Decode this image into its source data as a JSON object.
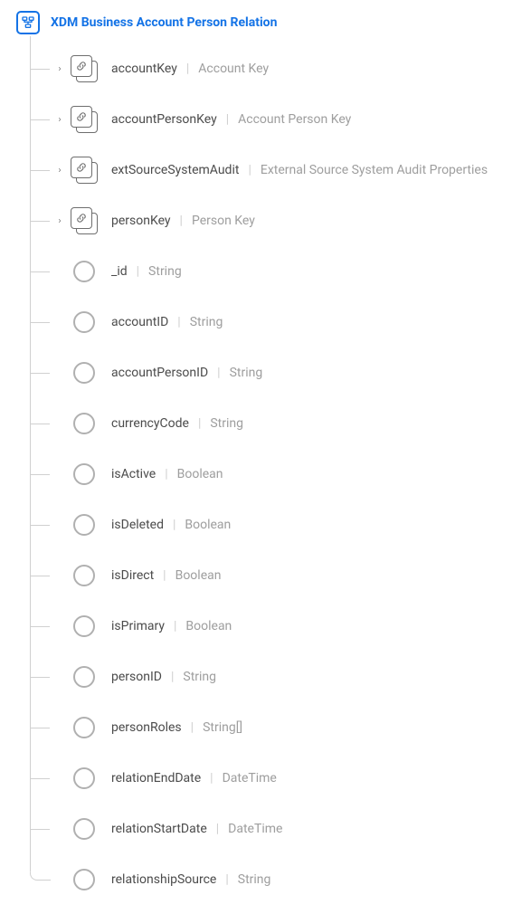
{
  "root": {
    "title": "XDM Business Account Person Relation",
    "icon": "schema-icon"
  },
  "nodes": [
    {
      "kind": "object",
      "expandable": true,
      "name": "accountKey",
      "desc": "Account Key"
    },
    {
      "kind": "object",
      "expandable": true,
      "name": "accountPersonKey",
      "desc": "Account Person Key"
    },
    {
      "kind": "object",
      "expandable": true,
      "name": "extSourceSystemAudit",
      "desc": "External Source System Audit Properties"
    },
    {
      "kind": "object",
      "expandable": true,
      "name": "personKey",
      "desc": "Person Key"
    },
    {
      "kind": "leaf",
      "expandable": false,
      "name": "_id",
      "desc": "String"
    },
    {
      "kind": "leaf",
      "expandable": false,
      "name": "accountID",
      "desc": "String"
    },
    {
      "kind": "leaf",
      "expandable": false,
      "name": "accountPersonID",
      "desc": "String"
    },
    {
      "kind": "leaf",
      "expandable": false,
      "name": "currencyCode",
      "desc": "String"
    },
    {
      "kind": "leaf",
      "expandable": false,
      "name": "isActive",
      "desc": "Boolean"
    },
    {
      "kind": "leaf",
      "expandable": false,
      "name": "isDeleted",
      "desc": "Boolean"
    },
    {
      "kind": "leaf",
      "expandable": false,
      "name": "isDirect",
      "desc": "Boolean"
    },
    {
      "kind": "leaf",
      "expandable": false,
      "name": "isPrimary",
      "desc": "Boolean"
    },
    {
      "kind": "leaf",
      "expandable": false,
      "name": "personID",
      "desc": "String"
    },
    {
      "kind": "leaf",
      "expandable": false,
      "name": "personRoles",
      "desc": "String[]"
    },
    {
      "kind": "leaf",
      "expandable": false,
      "name": "relationEndDate",
      "desc": "DateTime"
    },
    {
      "kind": "leaf",
      "expandable": false,
      "name": "relationStartDate",
      "desc": "DateTime"
    },
    {
      "kind": "leaf",
      "expandable": false,
      "name": "relationshipSource",
      "desc": "String"
    }
  ],
  "glyphs": {
    "chevron_right": "›"
  }
}
